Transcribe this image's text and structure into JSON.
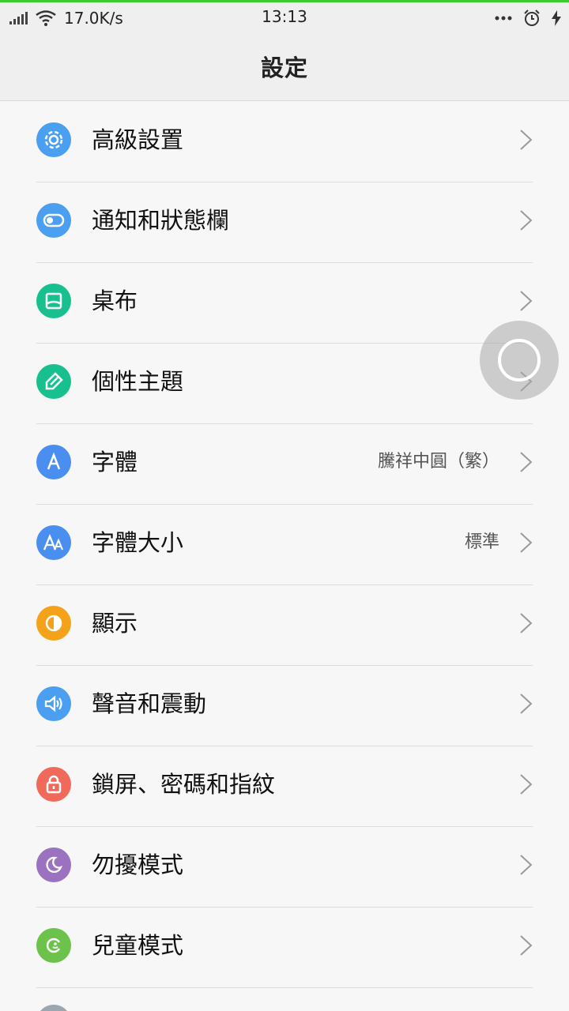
{
  "status_bar": {
    "net_speed": "17.0K/s",
    "time": "13:13",
    "icons": [
      "signal-icon",
      "wifi-icon",
      "more-dots-icon",
      "alarm-icon",
      "charging-icon"
    ]
  },
  "header": {
    "title": "設定"
  },
  "items": [
    {
      "label": "高級設置",
      "value": "",
      "icon": "gear-icon",
      "color": "#4a9ff0"
    },
    {
      "label": "通知和狀態欄",
      "value": "",
      "icon": "toggle-icon",
      "color": "#4a9ff0"
    },
    {
      "label": "桌布",
      "value": "",
      "icon": "wallpaper-icon",
      "color": "#19c08f"
    },
    {
      "label": "個性主題",
      "value": "",
      "icon": "brush-icon",
      "color": "#19c08f"
    },
    {
      "label": "字體",
      "value": "騰祥中圓（繁）",
      "icon": "font-icon",
      "color": "#4a8ff0"
    },
    {
      "label": "字體大小",
      "value": "標準",
      "icon": "font-size-icon",
      "color": "#4a8ff0"
    },
    {
      "label": "顯示",
      "value": "",
      "icon": "display-icon",
      "color": "#f5a21b"
    },
    {
      "label": "聲音和震動",
      "value": "",
      "icon": "speaker-icon",
      "color": "#4a9ff0"
    },
    {
      "label": "鎖屏、密碼和指紋",
      "value": "",
      "icon": "lock-icon",
      "color": "#f06a5c"
    },
    {
      "label": "勿擾模式",
      "value": "",
      "icon": "moon-icon",
      "color": "#9a72c0"
    },
    {
      "label": "兒童模式",
      "value": "",
      "icon": "kids-icon",
      "color": "#6cc24a"
    }
  ]
}
